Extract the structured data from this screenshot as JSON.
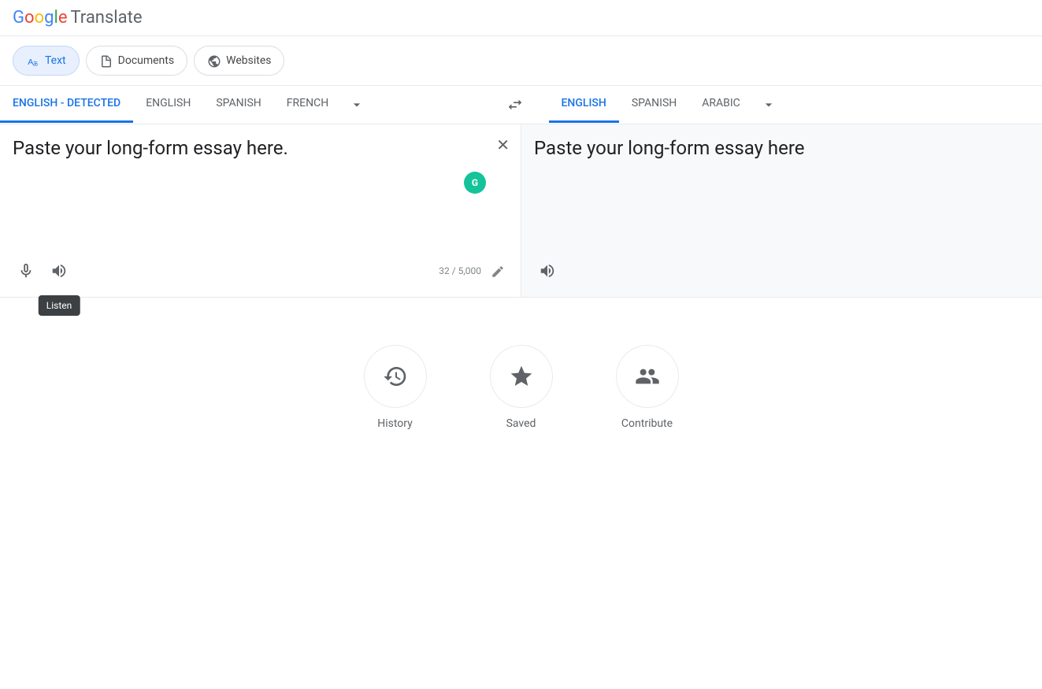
{
  "header": {
    "logo_google": "Google",
    "logo_translate": "Translate",
    "google_letters": [
      "G",
      "o",
      "o",
      "g",
      "l",
      "e"
    ]
  },
  "mode_tabs": [
    {
      "id": "text",
      "label": "Text",
      "active": true
    },
    {
      "id": "documents",
      "label": "Documents",
      "active": false
    },
    {
      "id": "websites",
      "label": "Websites",
      "active": false
    }
  ],
  "source_lang_tabs": [
    {
      "id": "english-detected",
      "label": "ENGLISH - DETECTED",
      "active": true
    },
    {
      "id": "english",
      "label": "ENGLISH",
      "active": false
    },
    {
      "id": "spanish",
      "label": "SPANISH",
      "active": false
    },
    {
      "id": "french",
      "label": "FRENCH",
      "active": false
    }
  ],
  "target_lang_tabs": [
    {
      "id": "english",
      "label": "ENGLISH",
      "active": true
    },
    {
      "id": "spanish",
      "label": "SPANISH",
      "active": false
    },
    {
      "id": "arabic",
      "label": "ARABIC",
      "active": false
    }
  ],
  "source_text": "Paste your long-form essay here.",
  "target_text": "Paste your long-form essay here",
  "char_count": "32 / 5,000",
  "bottom_actions": [
    {
      "id": "history",
      "label": "History"
    },
    {
      "id": "saved",
      "label": "Saved"
    },
    {
      "id": "contribute",
      "label": "Contribute"
    }
  ],
  "tooltip": {
    "listen": "Listen"
  }
}
